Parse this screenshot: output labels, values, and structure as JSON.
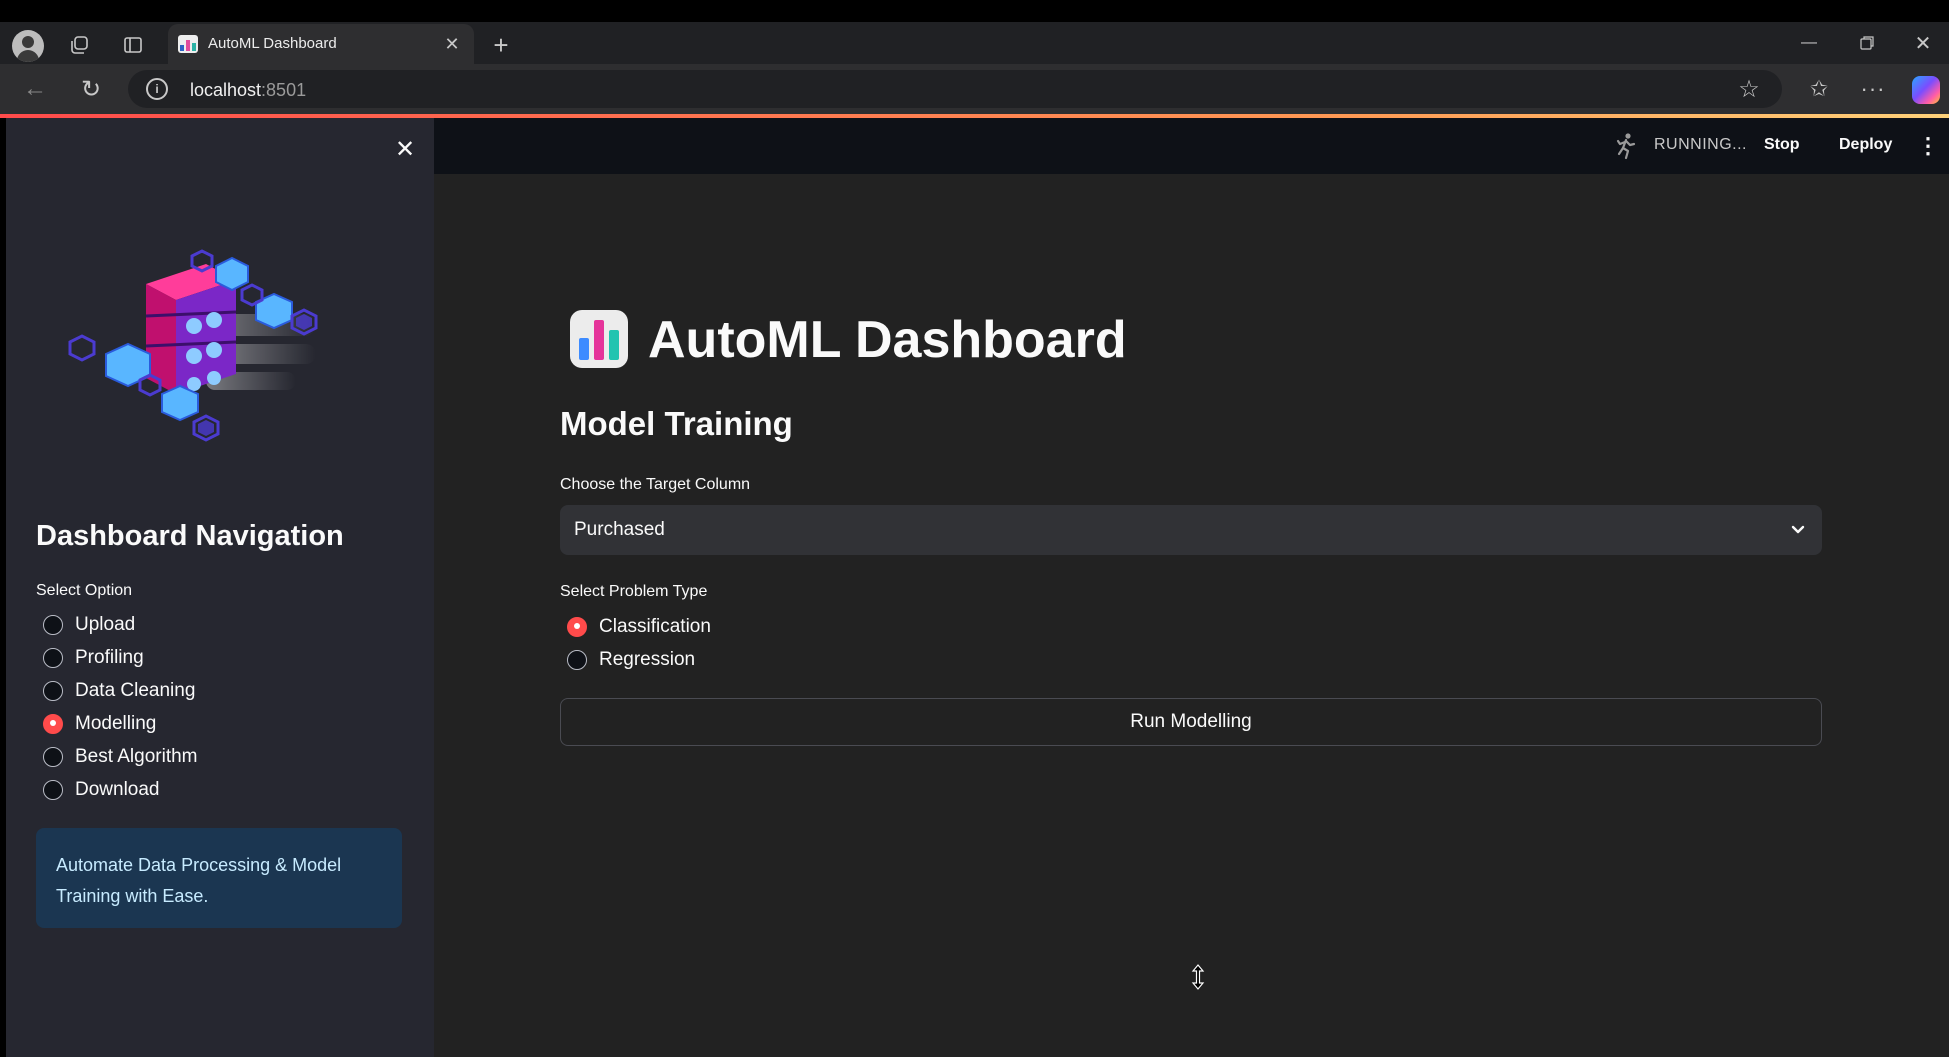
{
  "browser": {
    "tab_title": "AutoML Dashboard",
    "url_host": "localhost",
    "url_port": ":8501",
    "page_load_progress": 1.0,
    "icons": [
      "profile-icon",
      "workspaces-icon",
      "tab-actions-icon",
      "close-icon",
      "plus-icon",
      "back-arrow-icon",
      "reload-icon",
      "info-icon",
      "star-icon",
      "favorites-icon",
      "more-icon",
      "copilot-icon",
      "minimize-icon",
      "restore-icon",
      "close-icon"
    ]
  },
  "header": {
    "status": "RUNNING...",
    "stop_label": "Stop",
    "deploy_label": "Deploy",
    "icons": [
      "running-man-icon",
      "kebab-menu-icon"
    ]
  },
  "sidebar": {
    "title": "Dashboard Navigation",
    "select_label": "Select Option",
    "options": [
      {
        "label": "Upload",
        "selected": false
      },
      {
        "label": "Profiling",
        "selected": false
      },
      {
        "label": "Data Cleaning",
        "selected": false
      },
      {
        "label": "Modelling",
        "selected": true
      },
      {
        "label": "Best Algorithm",
        "selected": false
      },
      {
        "label": "Download",
        "selected": false
      }
    ],
    "info_text": "Automate Data Processing & Model Training with Ease.",
    "illustration": "isometric-data-cubes-illustration"
  },
  "main": {
    "title": "AutoML Dashboard",
    "title_icon": "bar-chart-icon",
    "section_title": "Model Training",
    "target_label": "Choose the Target Column",
    "target_value": "Purchased",
    "problem_label": "Select Problem Type",
    "problem_options": [
      {
        "label": "Classification",
        "selected": true
      },
      {
        "label": "Regression",
        "selected": false
      }
    ],
    "run_button_label": "Run Modelling"
  },
  "colors": {
    "accent": "#ff4b4b",
    "app_background": "#0e1117",
    "main_background": "#222222",
    "sidebar_background": "#262730",
    "info_background": "#1b3651",
    "info_text": "#c7ebff"
  }
}
